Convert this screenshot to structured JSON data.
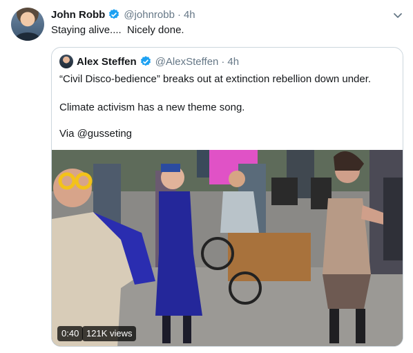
{
  "tweet": {
    "author_name": "John Robb",
    "handle": "@johnrobb",
    "separator": "·",
    "time": "4h",
    "text": "Staying alive....  Nicely done."
  },
  "quote": {
    "author_name": "Alex Steffen",
    "handle": "@AlexSteffen",
    "separator": "·",
    "time": "4h",
    "line1": "“Civil Disco-bedience” breaks out at extinction rebellion down under.",
    "line2": "Climate activism has a new theme song.",
    "line3": "Via @gusseting",
    "video": {
      "duration": "0:40",
      "views": "121K views"
    }
  },
  "colors": {
    "text_primary": "#14171a",
    "text_secondary": "#657786",
    "verified_blue": "#1da1f2",
    "border": "#ccd6dd"
  },
  "icons": [
    "verified-badge-icon",
    "chevron-down-icon"
  ]
}
